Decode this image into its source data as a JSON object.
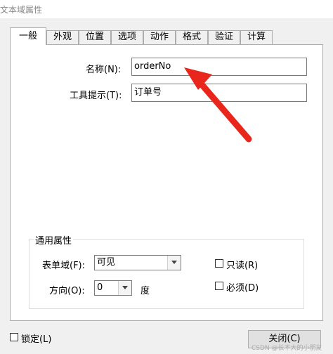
{
  "window": {
    "title": "文本域属性"
  },
  "tabs": [
    {
      "label": "一般",
      "active": true
    },
    {
      "label": "外观",
      "active": false
    },
    {
      "label": "位置",
      "active": false
    },
    {
      "label": "选项",
      "active": false
    },
    {
      "label": "动作",
      "active": false
    },
    {
      "label": "格式",
      "active": false
    },
    {
      "label": "验证",
      "active": false
    },
    {
      "label": "计算",
      "active": false
    }
  ],
  "general": {
    "name_label": "名称(N):",
    "name_value": "orderNo",
    "tooltip_label": "工具提示(T):",
    "tooltip_value": "订单号"
  },
  "common_properties": {
    "title": "通用属性",
    "form_field_label": "表单域(F):",
    "form_field_value": "可见",
    "readonly_label": "只读(R)",
    "readonly_checked": false,
    "orientation_label": "方向(O):",
    "orientation_value": "0",
    "orientation_unit": "度",
    "required_label": "必须(D)",
    "required_checked": false
  },
  "footer": {
    "locked_label": "锁定(L)",
    "locked_checked": false,
    "close_label": "关闭(C)",
    "watermark": "CSDN @长不大的小朋友"
  },
  "annotation": {
    "color": "#e8261c"
  }
}
